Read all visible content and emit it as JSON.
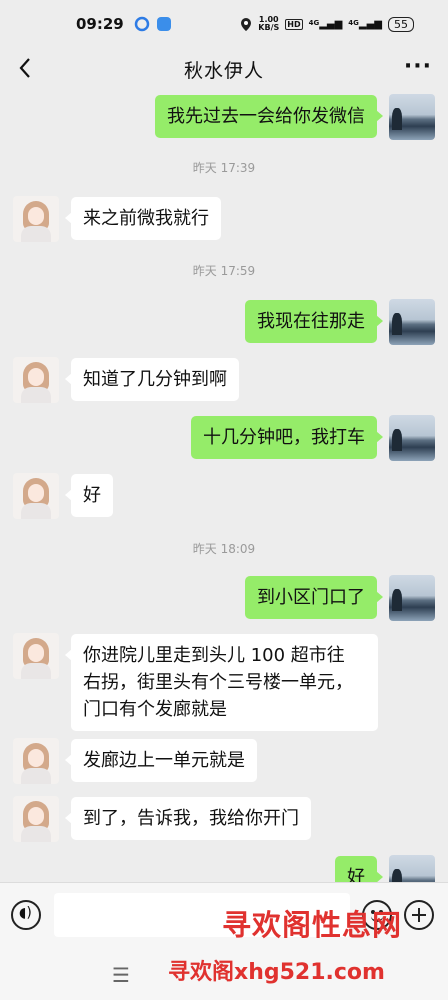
{
  "status_bar": {
    "time": "09:29",
    "net_speed_value": "1.00",
    "net_speed_unit": "KB/S",
    "hd_label": "HD",
    "signal1": "4G",
    "signal2": "4G",
    "battery": "55"
  },
  "header": {
    "title": "秋水伊人",
    "more_label": "···"
  },
  "messages": [
    {
      "sender": "me",
      "text": "我先过去一会给你发微信"
    },
    {
      "type": "time",
      "text": "昨天 17:39"
    },
    {
      "sender": "her",
      "text": "来之前微我就行"
    },
    {
      "type": "time",
      "text": "昨天 17:59"
    },
    {
      "sender": "me",
      "text": "我现在往那走"
    },
    {
      "sender": "her",
      "text": "知道了几分钟到啊"
    },
    {
      "sender": "me",
      "text": "十几分钟吧，我打车"
    },
    {
      "sender": "her",
      "text": "好"
    },
    {
      "type": "time",
      "text": "昨天 18:09"
    },
    {
      "sender": "me",
      "text": "到小区门口了"
    },
    {
      "sender": "her",
      "lines": [
        "你进院儿里走到头儿 100 超市往",
        "右拐，街里头有个三号楼一单元，",
        "门口有个发廊就是"
      ]
    },
    {
      "sender": "her",
      "text": "发廊边上一单元就是"
    },
    {
      "sender": "her",
      "text": "到了，告诉我，我给你开门"
    },
    {
      "sender": "me",
      "text": "好"
    }
  ],
  "input_bar": {
    "voice_icon": "voice-icon",
    "emoji_icon": "emoji-icon",
    "plus_icon": "plus-icon"
  },
  "system_nav": {
    "menu_label": "☰"
  },
  "watermark": {
    "line1": "寻欢阁性息网",
    "line2": "寻欢阁xhg521.com"
  },
  "colors": {
    "me_bubble": "#95ec69",
    "her_bubble": "#ffffff",
    "background": "#ededed",
    "watermark": "#e0322f"
  }
}
